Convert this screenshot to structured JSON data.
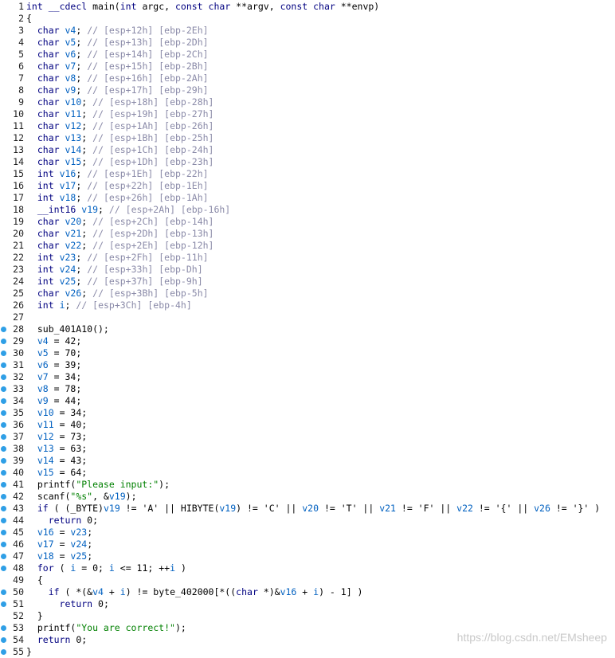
{
  "code_lines": [
    {
      "num": "1",
      "text": "int __cdecl main(int argc, const char **argv, const char **envp)",
      "bp": false
    },
    {
      "num": "2",
      "text": "{",
      "bp": false
    },
    {
      "num": "3",
      "text": "  char v4; // [esp+12h] [ebp-2Eh]",
      "bp": false
    },
    {
      "num": "4",
      "text": "  char v5; // [esp+13h] [ebp-2Dh]",
      "bp": false
    },
    {
      "num": "5",
      "text": "  char v6; // [esp+14h] [ebp-2Ch]",
      "bp": false
    },
    {
      "num": "6",
      "text": "  char v7; // [esp+15h] [ebp-2Bh]",
      "bp": false
    },
    {
      "num": "7",
      "text": "  char v8; // [esp+16h] [ebp-2Ah]",
      "bp": false
    },
    {
      "num": "8",
      "text": "  char v9; // [esp+17h] [ebp-29h]",
      "bp": false
    },
    {
      "num": "9",
      "text": "  char v10; // [esp+18h] [ebp-28h]",
      "bp": false
    },
    {
      "num": "10",
      "text": "  char v11; // [esp+19h] [ebp-27h]",
      "bp": false
    },
    {
      "num": "11",
      "text": "  char v12; // [esp+1Ah] [ebp-26h]",
      "bp": false
    },
    {
      "num": "12",
      "text": "  char v13; // [esp+1Bh] [ebp-25h]",
      "bp": false
    },
    {
      "num": "13",
      "text": "  char v14; // [esp+1Ch] [ebp-24h]",
      "bp": false
    },
    {
      "num": "14",
      "text": "  char v15; // [esp+1Dh] [ebp-23h]",
      "bp": false
    },
    {
      "num": "15",
      "text": "  int v16; // [esp+1Eh] [ebp-22h]",
      "bp": false
    },
    {
      "num": "16",
      "text": "  int v17; // [esp+22h] [ebp-1Eh]",
      "bp": false
    },
    {
      "num": "17",
      "text": "  int v18; // [esp+26h] [ebp-1Ah]",
      "bp": false
    },
    {
      "num": "18",
      "text": "  __int16 v19; // [esp+2Ah] [ebp-16h]",
      "bp": false
    },
    {
      "num": "19",
      "text": "  char v20; // [esp+2Ch] [ebp-14h]",
      "bp": false
    },
    {
      "num": "20",
      "text": "  char v21; // [esp+2Dh] [ebp-13h]",
      "bp": false
    },
    {
      "num": "21",
      "text": "  char v22; // [esp+2Eh] [ebp-12h]",
      "bp": false
    },
    {
      "num": "22",
      "text": "  int v23; // [esp+2Fh] [ebp-11h]",
      "bp": false
    },
    {
      "num": "23",
      "text": "  int v24; // [esp+33h] [ebp-Dh]",
      "bp": false
    },
    {
      "num": "24",
      "text": "  int v25; // [esp+37h] [ebp-9h]",
      "bp": false
    },
    {
      "num": "25",
      "text": "  char v26; // [esp+3Bh] [ebp-5h]",
      "bp": false
    },
    {
      "num": "26",
      "text": "  int i; // [esp+3Ch] [ebp-4h]",
      "bp": false
    },
    {
      "num": "27",
      "text": "",
      "bp": false
    },
    {
      "num": "28",
      "text": "  sub_401A10();",
      "bp": true
    },
    {
      "num": "29",
      "text": "  v4 = 42;",
      "bp": true
    },
    {
      "num": "30",
      "text": "  v5 = 70;",
      "bp": true
    },
    {
      "num": "31",
      "text": "  v6 = 39;",
      "bp": true
    },
    {
      "num": "32",
      "text": "  v7 = 34;",
      "bp": true
    },
    {
      "num": "33",
      "text": "  v8 = 78;",
      "bp": true
    },
    {
      "num": "34",
      "text": "  v9 = 44;",
      "bp": true
    },
    {
      "num": "35",
      "text": "  v10 = 34;",
      "bp": true
    },
    {
      "num": "36",
      "text": "  v11 = 40;",
      "bp": true
    },
    {
      "num": "37",
      "text": "  v12 = 73;",
      "bp": true
    },
    {
      "num": "38",
      "text": "  v13 = 63;",
      "bp": true
    },
    {
      "num": "39",
      "text": "  v14 = 43;",
      "bp": true
    },
    {
      "num": "40",
      "text": "  v15 = 64;",
      "bp": true
    },
    {
      "num": "41",
      "text": "  printf(\"Please input:\");",
      "bp": true
    },
    {
      "num": "42",
      "text": "  scanf(\"%s\", &v19);",
      "bp": true
    },
    {
      "num": "43",
      "text": "  if ( (_BYTE)v19 != 'A' || HIBYTE(v19) != 'C' || v20 != 'T' || v21 != 'F' || v22 != '{' || v26 != '}' )",
      "bp": true
    },
    {
      "num": "44",
      "text": "    return 0;",
      "bp": true
    },
    {
      "num": "45",
      "text": "  v16 = v23;",
      "bp": true
    },
    {
      "num": "46",
      "text": "  v17 = v24;",
      "bp": true
    },
    {
      "num": "47",
      "text": "  v18 = v25;",
      "bp": true
    },
    {
      "num": "48",
      "text": "  for ( i = 0; i <= 11; ++i )",
      "bp": true
    },
    {
      "num": "49",
      "text": "  {",
      "bp": false
    },
    {
      "num": "50",
      "text": "    if ( *(&v4 + i) != byte_402000[*((char *)&v16 + i) - 1] )",
      "bp": true
    },
    {
      "num": "51",
      "text": "      return 0;",
      "bp": true
    },
    {
      "num": "52",
      "text": "  }",
      "bp": false
    },
    {
      "num": "53",
      "text": "  printf(\"You are correct!\");",
      "bp": true
    },
    {
      "num": "54",
      "text": "  return 0;",
      "bp": true
    },
    {
      "num": "55",
      "text": "}",
      "bp": true
    }
  ],
  "watermark": "https://blog.csdn.net/EMsheep",
  "colors": {
    "keyword": "#000080",
    "variable": "#0060c0",
    "comment": "#8a8aa8",
    "string": "#008000",
    "breakpoint": "#2f9fe6"
  }
}
